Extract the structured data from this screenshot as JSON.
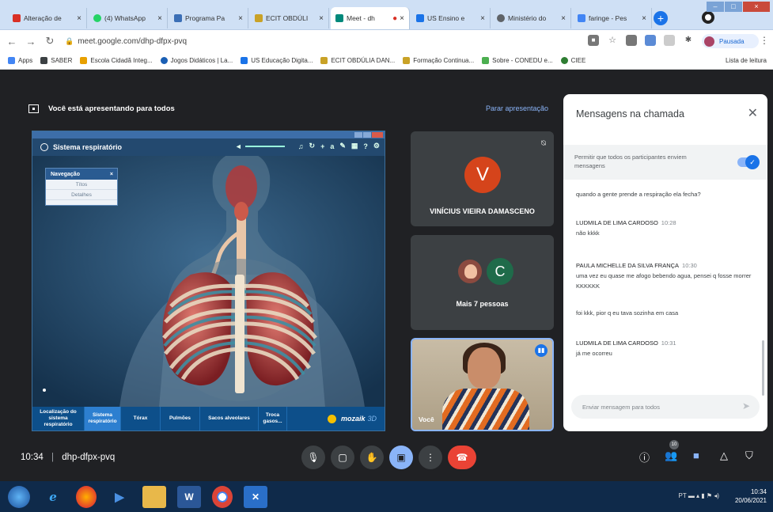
{
  "browser": {
    "tabs": [
      {
        "title": "Alteração de",
        "color": "#d93025"
      },
      {
        "title": "(4) WhatsApp",
        "color": "#25d366"
      },
      {
        "title": "Programa Pa",
        "color": "#3b6fb6"
      },
      {
        "title": "ECIT OBDÚLI",
        "color": "#c9a227"
      },
      {
        "title": "Meet - dh",
        "color": "#00897b",
        "active": true
      },
      {
        "title": "US Ensino e",
        "color": "#1a73e8"
      },
      {
        "title": "Ministério do",
        "color": "#5f6368"
      },
      {
        "title": "faringe - Pes",
        "color": "#4285f4"
      }
    ],
    "new_tab": "+",
    "url": "meet.google.com/dhp-dfpx-pvq",
    "profile_label": "Pausada",
    "bookmarks": [
      {
        "label": "Apps",
        "color": "#4285f4"
      },
      {
        "label": "SABER",
        "color": "#3c4043"
      },
      {
        "label": "Escola Cidadã Integ...",
        "color": "#e8a000"
      },
      {
        "label": "Jogos Didáticos | La...",
        "color": "#1a5fb4"
      },
      {
        "label": "US Educação Digita...",
        "color": "#1a73e8"
      },
      {
        "label": "ECIT OBDÚLIA DAN...",
        "color": "#c9a227"
      },
      {
        "label": "Formação Continua...",
        "color": "#c9a227"
      },
      {
        "label": "Sobre - CONEDU e...",
        "color": "#4caf50"
      },
      {
        "label": "CIEE",
        "color": "#2e7d32"
      }
    ],
    "reading_list": "Lista de leitura"
  },
  "meet": {
    "presenting_text": "Você está apresentando para todos",
    "stop_presenting": "Parar apresentação",
    "share": {
      "app_title": "Sistema respiratório",
      "nav_title": "Navegação",
      "nav_items": [
        "Títos",
        "Detalhes"
      ],
      "footer_tabs": [
        {
          "label": "Localização do sistema respiratório"
        },
        {
          "label": "Sistema respiratório",
          "selected": true
        },
        {
          "label": "Tórax"
        },
        {
          "label": "Pulmões"
        },
        {
          "label": "Sacos alveolares"
        },
        {
          "label": "Troca gasos..."
        }
      ],
      "brand": "mozaik",
      "brand_suffix": "3D"
    },
    "participants": {
      "main": {
        "name": "VINÍCIUS VIEIRA DAMASCENO",
        "initial": "V"
      },
      "more": {
        "label": "Mais 7 pessoas",
        "initial": "C"
      },
      "self": {
        "label": "Você"
      }
    },
    "chat": {
      "title": "Mensagens na chamada",
      "toggle_text": "Permitir que todos os participantes enviem mensagens",
      "messages": [
        {
          "sender": "",
          "time": "",
          "text": "quando a gente prende a respiração ela fecha?"
        },
        {
          "sender": "LUDMILA DE LIMA CARDOSO",
          "time": "10:28",
          "text": "não kkkk"
        },
        {
          "sender": "PAULA MICHELLE DA SILVA FRANÇA",
          "time": "10:30",
          "text": "uma vez eu quase me afogo bebendo agua, pensei q fosse morrer KKKKKK"
        },
        {
          "sender": "",
          "time": "",
          "text": "foi kkk, pior q eu tava sozinha em casa"
        },
        {
          "sender": "LUDMILA DE LIMA CARDOSO",
          "time": "10:31",
          "text": "já me ocorreu"
        }
      ],
      "input_placeholder": "Enviar mensagem para todos"
    },
    "bottom": {
      "time": "10:34",
      "separator": "|",
      "code": "dhp-dfpx-pvq",
      "participant_count": "10"
    }
  },
  "taskbar": {
    "clock_time": "10:34",
    "clock_date": "20/06/2021",
    "lang": "PT"
  }
}
